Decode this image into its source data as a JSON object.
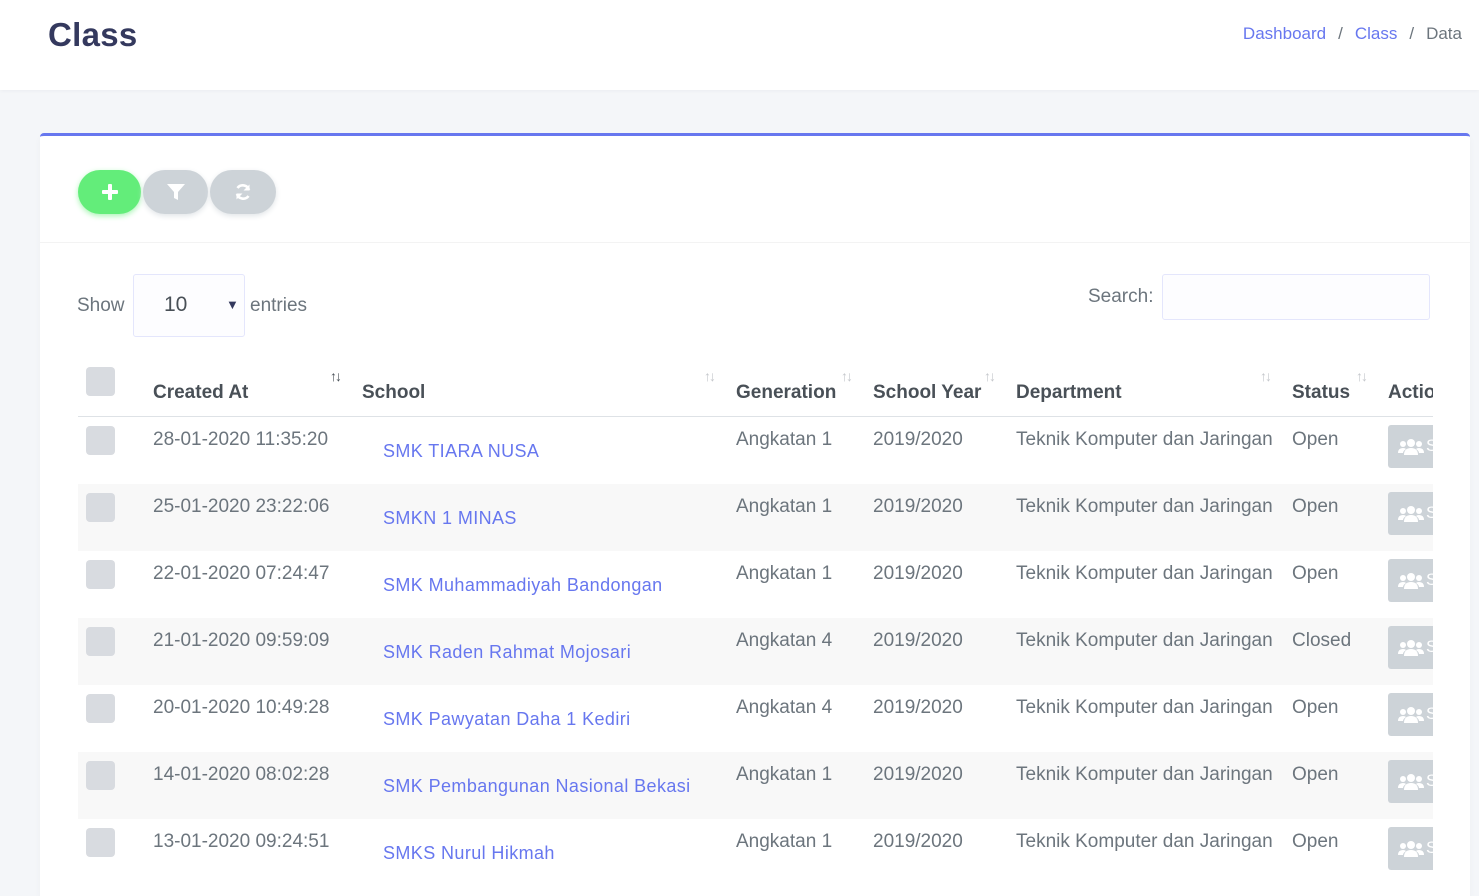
{
  "header": {
    "title": "Class",
    "breadcrumb": [
      {
        "label": "Dashboard"
      },
      {
        "label": "Class"
      },
      {
        "label": "Data"
      }
    ]
  },
  "toolbar": {
    "add_icon": "plus-icon",
    "filter_icon": "filter-icon",
    "refresh_icon": "refresh-icon",
    "colors": {
      "add": "#63ed7a",
      "secondary": "#cdd3d8",
      "accent": "#6777ef"
    }
  },
  "table_controls": {
    "show_label": "Show",
    "entries_value": "10",
    "entries_label": "entries",
    "search_label": "Search:",
    "search_value": ""
  },
  "table": {
    "columns": [
      "Created At",
      "School",
      "Generation",
      "School Year",
      "Department",
      "Status",
      "Actio"
    ],
    "action_icon": "users-icon",
    "action_label": "S",
    "rows": [
      {
        "created_at": "28-01-2020 11:35:20",
        "school": "SMK TIARA NUSA",
        "generation": "Angkatan 1",
        "school_year": "2019/2020",
        "department": "Teknik Komputer dan Jaringan",
        "status": "Open"
      },
      {
        "created_at": "25-01-2020 23:22:06",
        "school": "SMKN 1 MINAS",
        "generation": "Angkatan 1",
        "school_year": "2019/2020",
        "department": "Teknik Komputer dan Jaringan",
        "status": "Open"
      },
      {
        "created_at": "22-01-2020 07:24:47",
        "school": "SMK Muhammadiyah Bandongan",
        "generation": "Angkatan 1",
        "school_year": "2019/2020",
        "department": "Teknik Komputer dan Jaringan",
        "status": "Open"
      },
      {
        "created_at": "21-01-2020 09:59:09",
        "school": "SMK Raden Rahmat Mojosari",
        "generation": "Angkatan 4",
        "school_year": "2019/2020",
        "department": "Teknik Komputer dan Jaringan",
        "status": "Closed"
      },
      {
        "created_at": "20-01-2020 10:49:28",
        "school": "SMK Pawyatan Daha 1 Kediri",
        "generation": "Angkatan 4",
        "school_year": "2019/2020",
        "department": "Teknik Komputer dan Jaringan",
        "status": "Open"
      },
      {
        "created_at": "14-01-2020 08:02:28",
        "school": "SMK Pembangunan Nasional Bekasi",
        "generation": "Angkatan 1",
        "school_year": "2019/2020",
        "department": "Teknik Komputer dan Jaringan",
        "status": "Open"
      },
      {
        "created_at": "13-01-2020 09:24:51",
        "school": "SMKS Nurul Hikmah",
        "generation": "Angkatan 1",
        "school_year": "2019/2020",
        "department": "Teknik Komputer dan Jaringan",
        "status": "Open"
      }
    ]
  }
}
